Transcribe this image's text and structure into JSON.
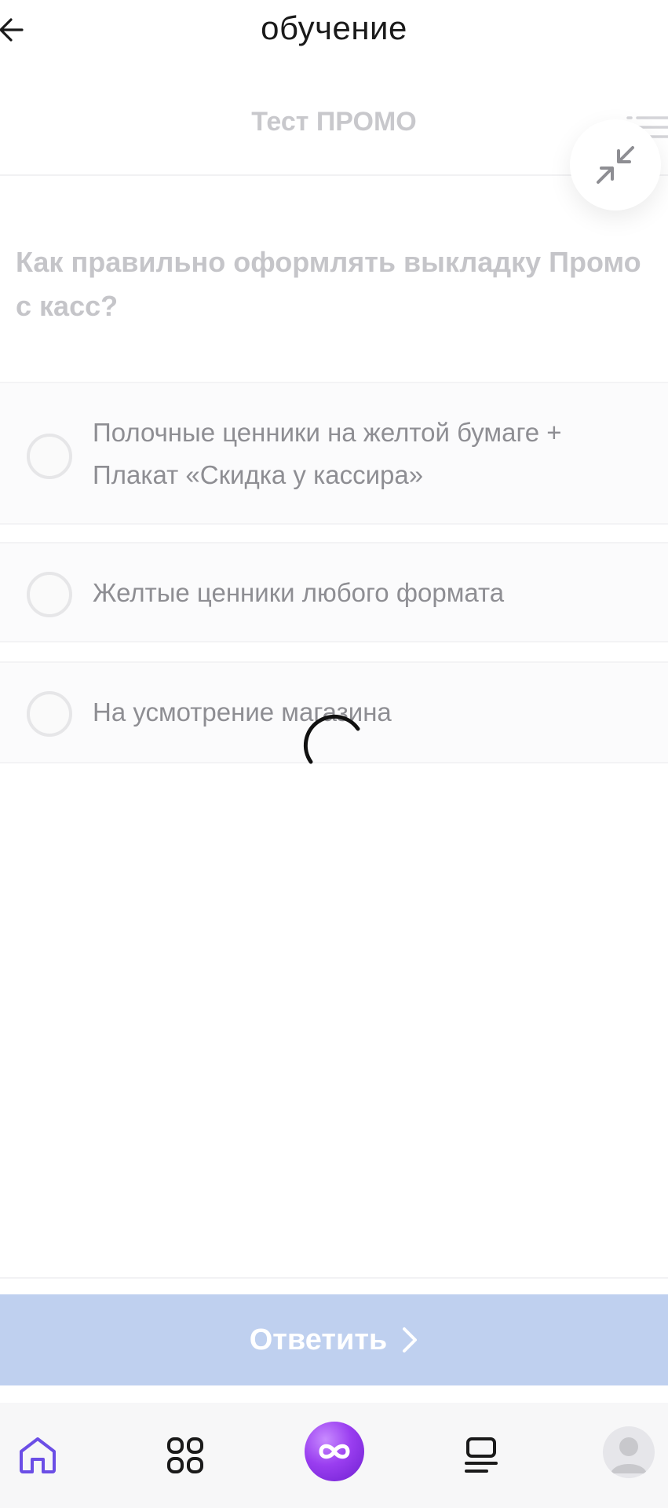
{
  "app": {
    "title": "обучение"
  },
  "test": {
    "title": "Тест ПРОМО"
  },
  "question": {
    "text": "Как правильно оформлять выкладку Промо с касс?"
  },
  "options": [
    {
      "label": "Полочные ценники на желтой бумаге + Плакат «Скидка у кассира»",
      "selected": false
    },
    {
      "label": "Желтые ценники любого формата",
      "selected": false
    },
    {
      "label": "На усмотрение магазина",
      "selected": false
    }
  ],
  "submit": {
    "label": "Ответить"
  },
  "colors": {
    "accent": "#bfd0ef",
    "nav_active": "#6b4ee6",
    "center_button": "#9a3ef0"
  },
  "icons": {
    "back": "arrow-left-icon",
    "list": "list-icon",
    "collapse": "collapse-icon",
    "spinner": "loading-spinner",
    "submit_chevron": "chevron-right-icon",
    "nav": [
      "home-icon",
      "apps-grid-icon",
      "infinity-icon",
      "feed-icon",
      "profile-avatar-icon"
    ]
  }
}
